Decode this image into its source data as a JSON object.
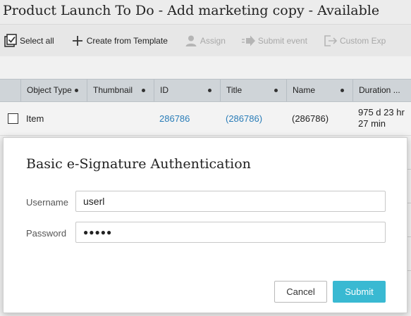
{
  "window": {
    "title": "Product Launch To Do - Add marketing copy - Available"
  },
  "toolbar": {
    "items": [
      {
        "label": "Select all",
        "icon": "checklist-icon",
        "enabled": true
      },
      {
        "label": "Create from Template",
        "icon": "plus-icon",
        "enabled": true
      },
      {
        "label": "Assign",
        "icon": "person-icon",
        "enabled": false
      },
      {
        "label": "Submit event",
        "icon": "arrow-right-icon",
        "enabled": false
      },
      {
        "label": "Custom Exp",
        "icon": "export-icon",
        "enabled": false
      }
    ]
  },
  "grid": {
    "columns": [
      "Object Type",
      "Thumbnail",
      "ID",
      "Title",
      "Name",
      "Duration ..."
    ],
    "rows": [
      {
        "object_type": "Item",
        "thumbnail": "",
        "id": "286786",
        "title": "(286786)",
        "name": "(286786)",
        "duration_line1": "975 d 23 hr",
        "duration_line2": "27 min"
      }
    ]
  },
  "dialog": {
    "title": "Basic e-Signature Authentication",
    "username_label": "Username",
    "username_value": "userl",
    "password_label": "Password",
    "password_value": "●●●●●",
    "cancel_label": "Cancel",
    "submit_label": "Submit"
  },
  "colors": {
    "accent": "#39b9d2",
    "link": "#2a7db8",
    "header_bg": "#cfd4d8"
  }
}
